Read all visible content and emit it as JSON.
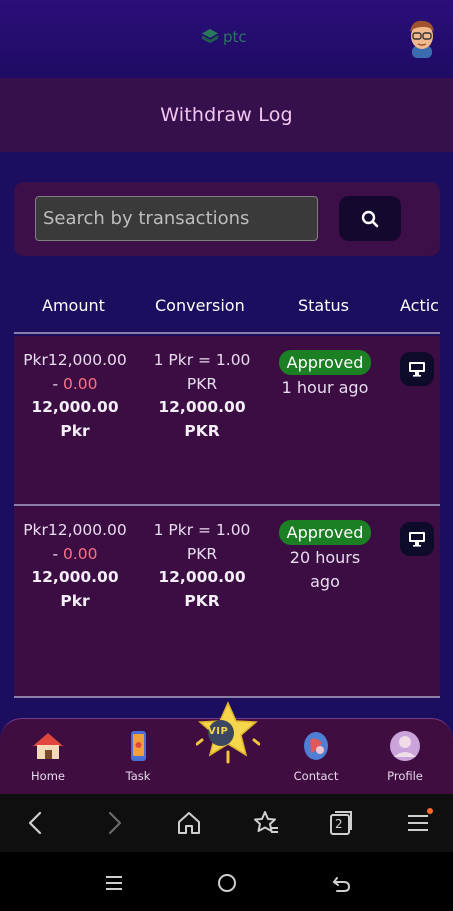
{
  "header": {
    "logo_text": "ptc",
    "title": "Withdraw Log"
  },
  "search": {
    "placeholder": "Search by transactions",
    "icon": "search-icon"
  },
  "table": {
    "columns": [
      "Amount",
      "Conversion",
      "Status",
      "Actic"
    ],
    "rows": [
      {
        "amount_line1": "Pkr12,000.00",
        "amount_dash": "- ",
        "amount_fee": "0.00",
        "amount_total": "12,000.00",
        "amount_currency": "Pkr",
        "conversion_rate": "1 Pkr = 1.00",
        "conversion_unit": "PKR",
        "conversion_total": "12,000.00",
        "conversion_currency": "PKR",
        "status": "Approved",
        "time_line1": "1 hour ago",
        "time_line2": "",
        "action_icon": "monitor-icon"
      },
      {
        "amount_line1": "Pkr12,000.00",
        "amount_dash": "- ",
        "amount_fee": "0.00",
        "amount_total": "12,000.00",
        "amount_currency": "Pkr",
        "conversion_rate": "1 Pkr = 1.00",
        "conversion_unit": "PKR",
        "conversion_total": "12,000.00",
        "conversion_currency": "PKR",
        "status": "Approved",
        "time_line1": "20 hours",
        "time_line2": "ago",
        "action_icon": "monitor-icon"
      }
    ]
  },
  "bottom_nav": {
    "items": [
      {
        "label": "Home",
        "icon": "house-icon"
      },
      {
        "label": "Task",
        "icon": "phone-icon"
      },
      {
        "label": "",
        "icon": "vip-star-icon"
      },
      {
        "label": "Contact",
        "icon": "contact-icon"
      },
      {
        "label": "Profile",
        "icon": "profile-icon"
      }
    ],
    "vip_text": "VIP"
  },
  "browser_bar": {
    "tab_count": "2",
    "icons": [
      "back-icon",
      "forward-icon",
      "home-icon",
      "bookmark-star-icon",
      "tabs-icon",
      "menu-icon"
    ]
  },
  "colors": {
    "approved": "#1b7f23",
    "fee_red": "#ff6f86",
    "row_bg": "#3b0d42",
    "title_pink": "#f2c6ee"
  }
}
